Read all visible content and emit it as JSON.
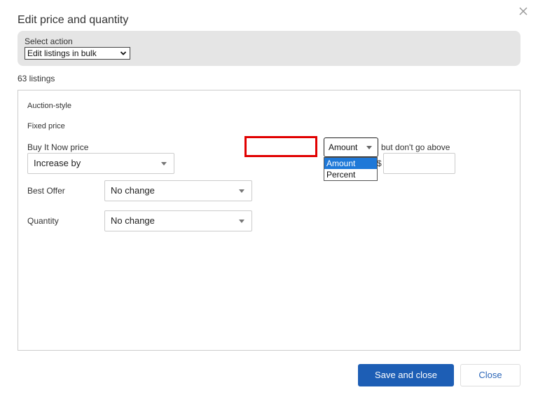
{
  "dialog": {
    "title": "Edit price and quantity",
    "close_icon": "close-icon"
  },
  "action": {
    "label": "Select action",
    "selected": "Edit listings in bulk"
  },
  "listings_count": "63 listings",
  "sections": {
    "auction": "Auction-style",
    "fixed": "Fixed price"
  },
  "buy_it_now": {
    "label": "Buy It Now price",
    "mode": "Increase by",
    "value": "",
    "unit_selected": "Amount",
    "unit_options": [
      "Amount",
      "Percent"
    ],
    "currency_symbol": "$",
    "cap_label": "but don't go above",
    "cap_value": ""
  },
  "best_offer": {
    "label": "Best Offer",
    "selected": "No change"
  },
  "quantity": {
    "label": "Quantity",
    "selected": "No change"
  },
  "buttons": {
    "save": "Save and close",
    "close": "Close"
  },
  "colors": {
    "primary": "#1d5eb5",
    "highlight": "#e10000",
    "option_selected": "#1e78d8"
  }
}
